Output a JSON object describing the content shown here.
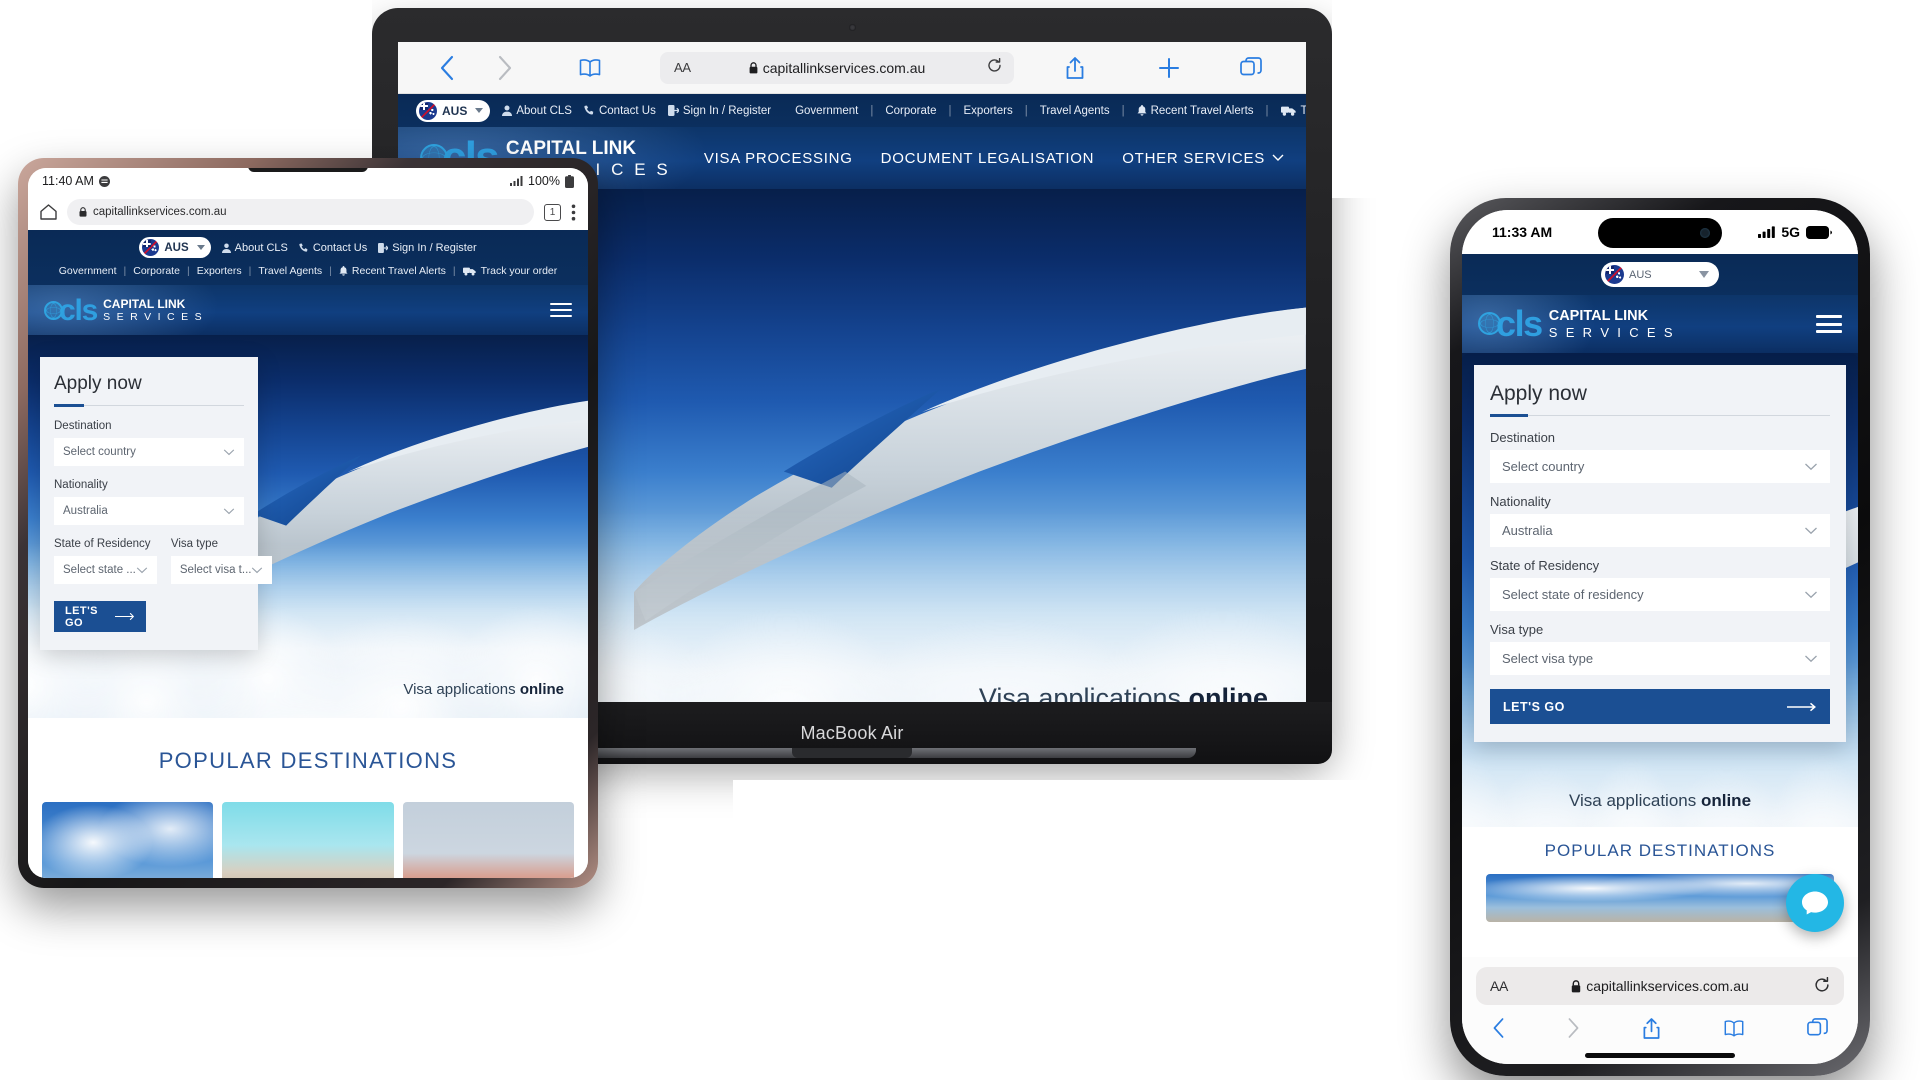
{
  "site": {
    "url": "capitallinkservices.com.au",
    "brand": {
      "abbr": "cls",
      "line1": "CAPITAL LINK",
      "line2": "S E R V I C E S"
    },
    "region": {
      "code": "AUS",
      "flag": "australia-flag"
    },
    "utility_links": [
      "About CLS",
      "Contact Us",
      "Sign In / Register"
    ],
    "audience_links": [
      "Government",
      "Corporate",
      "Exporters",
      "Travel Agents"
    ],
    "alert_link": "Recent Travel Alerts",
    "track_link": "Track your order",
    "main_nav": [
      "VISA PROCESSING",
      "DOCUMENT LEGALISATION",
      "OTHER SERVICES"
    ],
    "tagline_plain": "Visa applications ",
    "tagline_bold": "online",
    "popular_title": "POPULAR DESTINATIONS",
    "accent": "#1b4f93",
    "header_blue": "#0b2f5e"
  },
  "apply_form": {
    "title": "Apply now",
    "fields": [
      {
        "label": "Destination",
        "value": "Select country"
      },
      {
        "label": "Nationality",
        "value": "Australia"
      },
      {
        "label": "State of Residency",
        "value": "Select state of residency",
        "value_short": "Select state ..."
      },
      {
        "label": "Visa type",
        "value": "Select visa type",
        "value_short": "Select visa t..."
      }
    ],
    "submit": "LET'S GO"
  },
  "macbook": {
    "model_label": "MacBook Air",
    "browser": {
      "back_icon": "chevron-left-icon",
      "forward_icon": "chevron-right-icon",
      "bookmarks_icon": "book-icon",
      "text_size_label": "AA",
      "lock_icon": "lock-icon",
      "url": "capitallinkservices.com.au",
      "reload_icon": "reload-icon",
      "share_icon": "share-icon",
      "new_tab_icon": "plus-icon",
      "tabs_icon": "tabs-icon"
    }
  },
  "fold": {
    "status": {
      "time": "11:40 AM",
      "signal": "signal-icon",
      "battery": "100%"
    },
    "browser": {
      "home_icon": "home-icon",
      "lock_icon": "lock-icon",
      "url": "capitallinkservices.com.au",
      "tab_count": "1",
      "menu_icon": "more-vertical-icon"
    },
    "destinations": [
      "mosque",
      "forbidden-city",
      "hawa-mahal"
    ]
  },
  "iphone": {
    "status": {
      "time": "11:33 AM",
      "signal": "signal-icon",
      "network": "5G",
      "battery": "battery-icon"
    },
    "browser": {
      "text_size_label": "AA",
      "lock_icon": "lock-icon",
      "url": "capitallinkservices.com.au",
      "reload_icon": "reload-icon",
      "back_icon": "chevron-left-icon",
      "forward_icon": "chevron-right-icon",
      "share_icon": "share-icon",
      "bookmarks_icon": "book-icon",
      "tabs_icon": "tabs-icon"
    },
    "chat_icon": "chat-bubble-icon"
  }
}
